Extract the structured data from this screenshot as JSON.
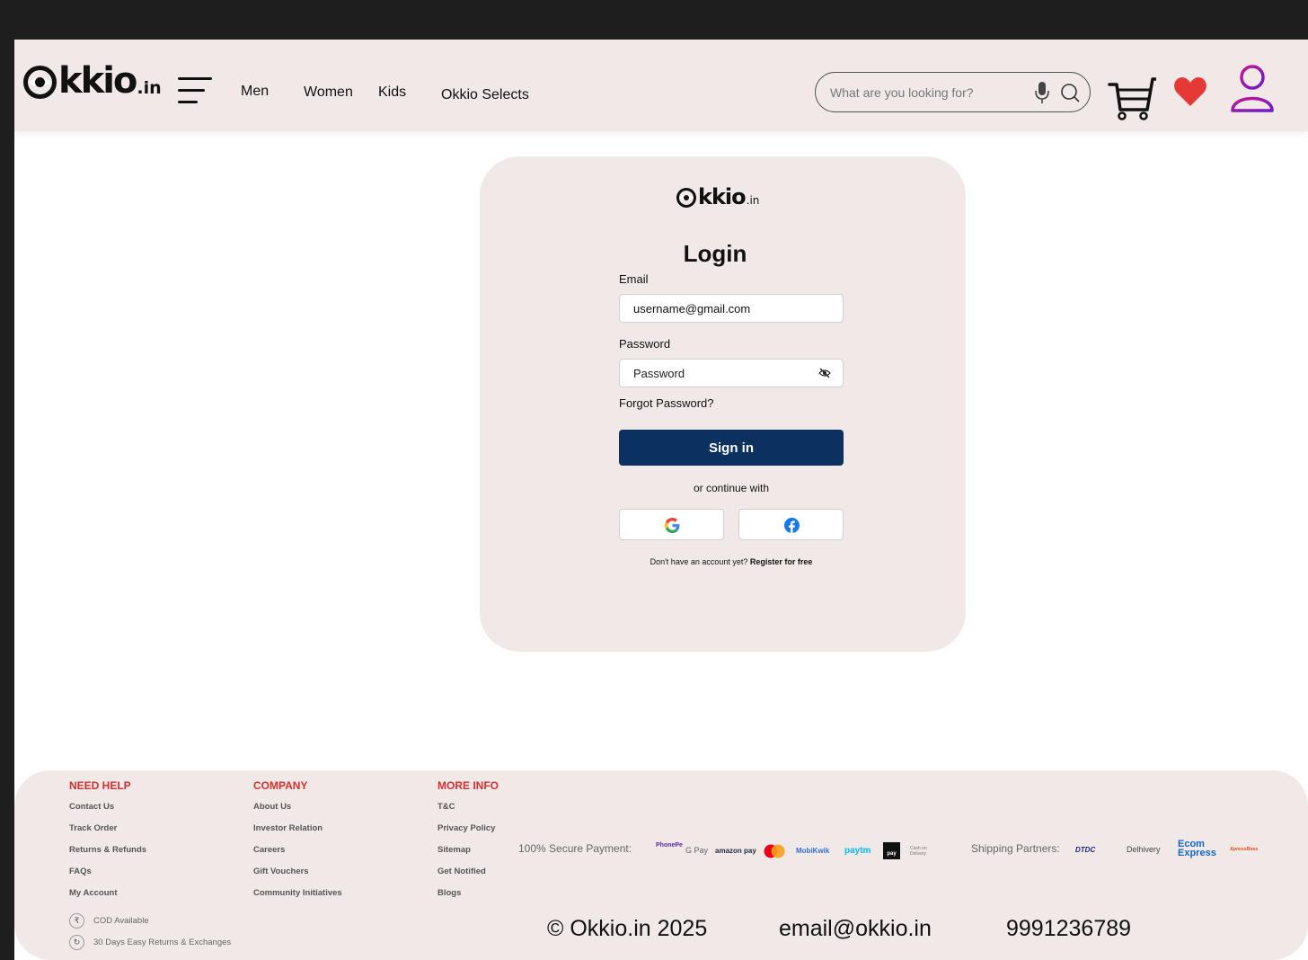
{
  "header": {
    "logo_text": "kkio",
    "logo_tld": ".in",
    "nav": [
      "Men",
      "Women",
      "Kids",
      "Okkio Selects"
    ],
    "search_placeholder": "What are you looking for?",
    "colors": {
      "background": "#f1e9e8",
      "heart": "#e53935",
      "user_gradient_start": "#c2188f",
      "user_gradient_end": "#6a1bcc"
    }
  },
  "login": {
    "logo_text": "kkio",
    "logo_tld": ".in",
    "title": "Login",
    "email_label": "Email",
    "email_value": "username@gmail.com",
    "password_label": "Password",
    "password_placeholder": "Password",
    "forgot": "Forgot Password?",
    "signin": "Sign in",
    "continue_with": "or continue with",
    "no_account": "Don't have an account yet?",
    "register": "Register for free",
    "colors": {
      "signin_bg": "#0b3160"
    }
  },
  "footer": {
    "need_help": {
      "heading": "NEED HELP",
      "links": [
        "Contact Us",
        "Track Order",
        "Returns & Refunds",
        "FAQs",
        "My Account"
      ],
      "badges": [
        "COD Available",
        "30 Days Easy Returns & Exchanges"
      ]
    },
    "company": {
      "heading": "COMPANY",
      "links": [
        "About Us",
        "Investor Relation",
        "Careers",
        "Gift Vouchers",
        "Community Initiatives"
      ]
    },
    "more_info": {
      "heading": "MORE INFO",
      "links": [
        "T&C",
        "Privacy Policy",
        "Sitemap",
        "Get Notified",
        "Blogs"
      ]
    },
    "payment_label": "100% Secure Payment:",
    "payment_methods": [
      "PhonePe",
      "G Pay",
      "amazon pay",
      "Mastercard",
      "MobiKwik",
      "paytm",
      "pay",
      "Cash on Delivery"
    ],
    "shipping_label": "Shipping Partners:",
    "shipping_partners": [
      "DTDC",
      "Delhivery",
      "Ecom Express",
      "XpressBees"
    ],
    "copyright": "© Okkio.in 2025",
    "email": "email@okkio.in",
    "phone": "9991236789",
    "colors": {
      "heading": "#d32f2f"
    }
  }
}
